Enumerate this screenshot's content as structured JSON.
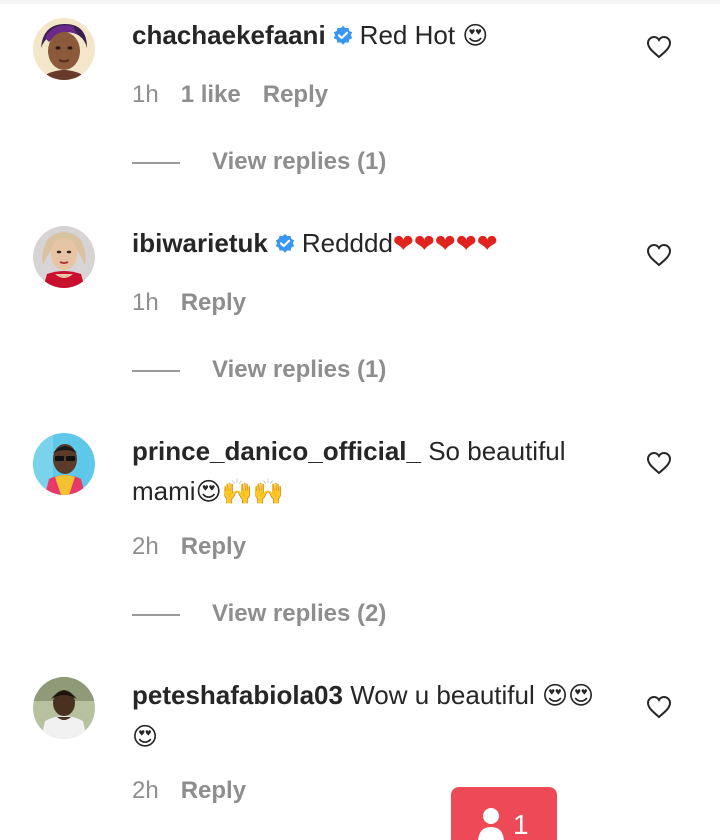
{
  "comments": [
    {
      "username": "chachaekefaani",
      "verified": true,
      "text": "Red Hot",
      "emojis": "😍",
      "time": "1h",
      "likes": "1 like",
      "reply": "Reply",
      "view_replies": "View replies (1)"
    },
    {
      "username": "ibiwarietuk",
      "verified": true,
      "text": "Redddd",
      "emojis": "❤❤❤❤❤",
      "time": "1h",
      "likes": "",
      "reply": "Reply",
      "view_replies": "View replies (1)"
    },
    {
      "username": "prince_danico_official_",
      "verified": false,
      "text": "So beautiful mami",
      "emojis": "😍🙌🙌",
      "time": "2h",
      "likes": "",
      "reply": "Reply",
      "view_replies": "View replies (2)"
    },
    {
      "username": "peteshafabiola03",
      "verified": false,
      "text": "Wow u beautiful",
      "emojis": "😍😍😍",
      "time": "2h",
      "likes": "",
      "reply": "Reply",
      "view_replies": ""
    }
  ],
  "activity_badge": {
    "count": "1",
    "icon": "person-icon"
  },
  "colors": {
    "verified_blue": "#3897f0",
    "muted_gray": "#8e8e8e",
    "badge_red": "#ed4956",
    "heart_red": "#e0231e"
  }
}
